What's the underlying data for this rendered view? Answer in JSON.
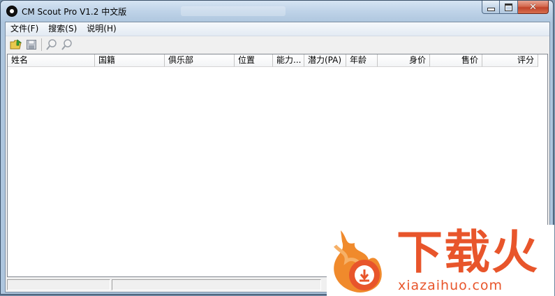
{
  "window": {
    "title": "CM Scout Pro V1.2 中文版",
    "accent": "#c1432a"
  },
  "menu": {
    "items": [
      "文件(F)",
      "搜索(S)",
      "说明(H)"
    ]
  },
  "toolbar": {
    "buttons": [
      "open-folder-icon",
      "save-icon",
      "search-icon",
      "search-alt-icon"
    ]
  },
  "list": {
    "columns": [
      "姓名",
      "国籍",
      "俱乐部",
      "位置",
      "能力...",
      "潜力(PA)",
      "年龄",
      "身价",
      "售价",
      "评分"
    ],
    "rows": []
  },
  "watermark": {
    "text": "下载火",
    "url": "xiazaihuo.com",
    "color": "#e8552b"
  }
}
